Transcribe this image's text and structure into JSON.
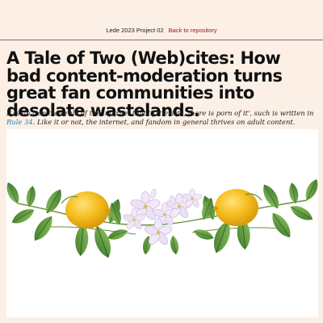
{
  "header": {
    "project_title": "Lede 2023 Project 02",
    "repo_link": "Back to repository"
  },
  "article": {
    "title": "A Tale of Two (Web)cites: How bad content-moderation turns great fan communities into desolate wastelands.",
    "lede_before_link": "It is an iron clad rule of the internet that 'if it exists, there is porn of it', such is written in ",
    "lede_link": "Rule 34",
    "lede_after_link": ". Like it or not, the internet, and fandom in general thrives on adult content."
  },
  "hero_image": {
    "icon": "lemon-branch-illustration",
    "colors": {
      "lemon": "#f2b81a",
      "leaf": "#5e9a3a",
      "blossom": "#e7ddf0"
    }
  }
}
